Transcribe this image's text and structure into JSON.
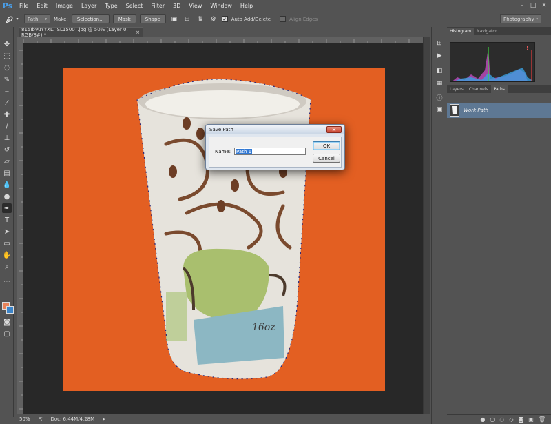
{
  "app": {
    "logo": "Ps",
    "menu": [
      "File",
      "Edit",
      "Image",
      "Layer",
      "Type",
      "Select",
      "Filter",
      "3D",
      "View",
      "Window",
      "Help"
    ],
    "window_controls": [
      "–",
      "□",
      "✕"
    ]
  },
  "options_bar": {
    "mode": "Path",
    "make_label": "Make:",
    "selection_button": "Selection...",
    "mask_button": "Mask",
    "shape_button": "Shape",
    "auto_add_delete_label": "Auto Add/Delete",
    "auto_add_delete_checked": true,
    "align_edges_label": "Align Edges",
    "align_edges_checked": false,
    "workspace": "Photography"
  },
  "document": {
    "tab_title": "815IbVuYYXL._SL1500_.jpg @ 50% (Layer 0, RGB/8#) *",
    "tab_close": "×",
    "background_color": "#e35f22",
    "cup_label": "16oz"
  },
  "status_bar": {
    "zoom": "50%",
    "doc_size": "Doc: 6.44M/4.28M"
  },
  "panels": {
    "histogram_tabs": [
      "Histogram",
      "Navigator"
    ],
    "histogram_warning": "!",
    "layers_tabs": [
      "Layers",
      "Channels",
      "Paths"
    ],
    "active_layers_tab": "Paths",
    "path_item": "Work Path",
    "footer_icons": [
      "fill-path-icon",
      "stroke-path-icon",
      "load-selection-icon",
      "make-work-path-icon",
      "add-mask-icon",
      "new-path-icon",
      "delete-path-icon"
    ]
  },
  "dialog": {
    "title": "Save Path",
    "close": "✕",
    "name_label": "Name:",
    "name_value": "Path 1",
    "ok_label": "OK",
    "cancel_label": "Cancel"
  },
  "colors": {
    "foreground": "#e8835a",
    "background": "#3c84c8",
    "selection_highlight": "#5e7894"
  }
}
